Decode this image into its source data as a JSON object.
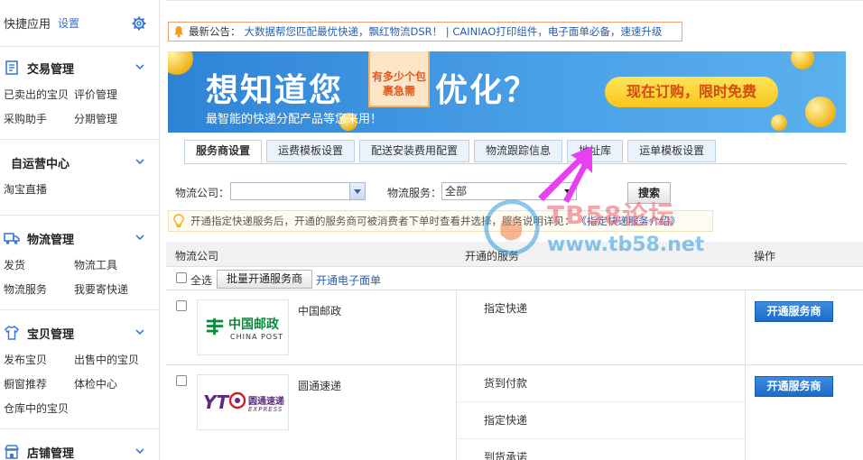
{
  "sidebar": {
    "title": "快捷应用",
    "settings_label": "设置",
    "groups": [
      {
        "title": "交易管理",
        "icon": "document-icon",
        "items": [
          "已卖出的宝贝",
          "评价管理",
          "采购助手",
          "分期管理"
        ]
      },
      {
        "title": "自运营中心",
        "icon": "",
        "items": [
          "淘宝直播"
        ]
      },
      {
        "title": "物流管理",
        "icon": "truck-icon",
        "items": [
          "发货",
          "物流工具",
          "物流服务",
          "我要寄快递"
        ]
      },
      {
        "title": "宝贝管理",
        "icon": "shirt-icon",
        "items": [
          "发布宝贝",
          "出售中的宝贝",
          "橱窗推荐",
          "体检中心",
          "仓库中的宝贝"
        ]
      },
      {
        "title": "店铺管理",
        "icon": "store-icon",
        "items": []
      }
    ]
  },
  "notice": {
    "label": "最新公告：",
    "text": "大数据帮您匹配最优快递，飘红物流DSR！ | CAINIAO打印组件，电子面单必备，速速升级"
  },
  "banner": {
    "headline_left": "想知道您",
    "tag": "有多少个包裹急需",
    "headline_right": "优化？",
    "subtitle": "最智能的快递分配产品等您来用！",
    "cta": "现在订购，限时免费"
  },
  "tabs": [
    "服务商设置",
    "运费模板设置",
    "配送安装费用配置",
    "物流跟踪信息",
    "地址库",
    "运单模板设置"
  ],
  "active_tab": 0,
  "filters": {
    "company_label": "物流公司：",
    "company_value": "",
    "service_label": "物流服务：",
    "service_value": "全部",
    "search_label": "搜索"
  },
  "tip": {
    "text": "开通指定快递服务后，开通的服务商可被消费者下单时查看并选择，服务说明详见：",
    "link": "《指定快递服务介绍》"
  },
  "table": {
    "headers": {
      "company": "物流公司",
      "services": "开通的服务",
      "action": "操作"
    },
    "select_all": "全选",
    "batch_button": "批量开通服务商",
    "esheet_link": "开通电子面单",
    "rows": [
      {
        "name": "中国邮政",
        "logo_cn": "中国邮政",
        "logo_en": "CHINA POST",
        "services": [
          "指定快递"
        ],
        "action": "开通服务商"
      },
      {
        "name": "圆通速递",
        "logo_cn": "圆通速递",
        "logo_en": "EXPRESS",
        "services": [
          "货到付款",
          "指定快递",
          "到货承诺"
        ],
        "action": "开通服务商"
      }
    ]
  },
  "watermark": {
    "line1": "TB58论坛",
    "line2": "www.tb58.net"
  },
  "colors": {
    "link": "#2a5db0",
    "primary_button": "#1b6bc9",
    "banner": "#2f83d6",
    "annotation_arrow": "#e83ff0"
  }
}
